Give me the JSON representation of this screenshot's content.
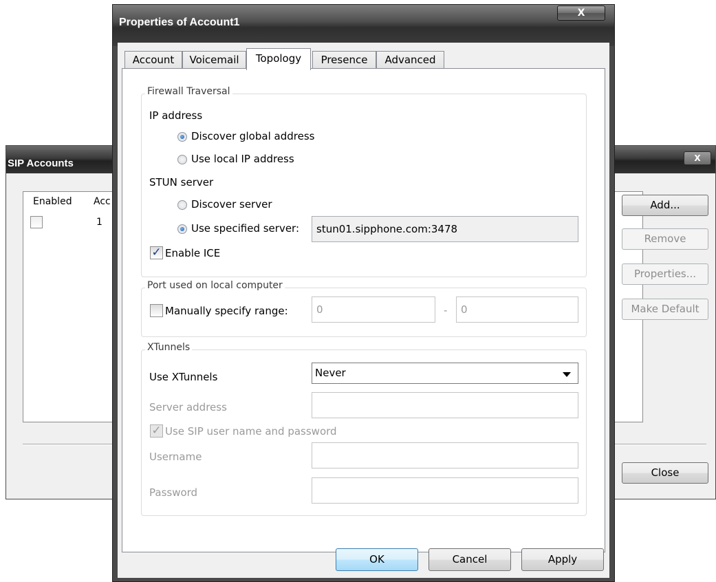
{
  "sip_accounts": {
    "title": "SIP Accounts",
    "close_glyph": "X",
    "columns": [
      "Enabled",
      "Acc"
    ],
    "rows": [
      {
        "account": "1"
      }
    ],
    "buttons": {
      "add": "Add...",
      "remove": "Remove",
      "properties": "Properties...",
      "make_default": "Make Default",
      "close": "Close"
    }
  },
  "dialog": {
    "title": "Properties of Account1",
    "close_glyph": "X",
    "tabs": [
      "Account",
      "Voicemail",
      "Topology",
      "Presence",
      "Advanced"
    ],
    "active_tab": "Topology",
    "firewall": {
      "legend": "Firewall Traversal",
      "ip_label": "IP address",
      "ip_discover": "Discover global address",
      "ip_local": "Use local IP address",
      "ip_selected": "Discover global address",
      "stun_label": "STUN server",
      "stun_discover": "Discover server",
      "stun_specified": "Use specified server:",
      "stun_selected": "Use specified server:",
      "stun_value": "stun01.sipphone.com:3478",
      "ice_label": "Enable ICE",
      "ice_checked": true
    },
    "port": {
      "legend": "Port used on local computer",
      "range_label": "Manually specify range:",
      "range_checked": false,
      "from": "0",
      "separator": "-",
      "to": "0"
    },
    "xtunnels": {
      "legend": "XTunnels",
      "use_label": "Use XTunnels",
      "use_value": "Never",
      "server_label": "Server address",
      "server_value": "",
      "sip_cred_label": "Use SIP user name and password",
      "sip_cred_checked": true,
      "username_label": "Username",
      "username_value": "",
      "password_label": "Password",
      "password_value": ""
    },
    "buttons": {
      "ok": "OK",
      "cancel": "Cancel",
      "apply": "Apply"
    }
  }
}
